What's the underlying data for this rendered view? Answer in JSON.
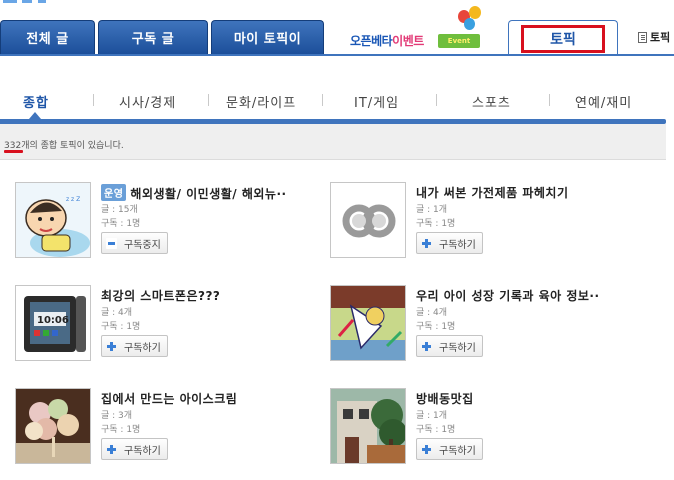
{
  "tabs": {
    "all_posts": "전체 글",
    "subscribed_posts": "구독 글",
    "my_topics": "마이 토픽이",
    "event": {
      "text_blue": "오픈베타",
      "text_pink": "이벤트",
      "ribbon": "Event"
    },
    "topic": "토픽",
    "right_cut": "토픽"
  },
  "subnav": {
    "items": [
      "종합",
      "시사/경제",
      "문화/라이프",
      "IT/게임",
      "스포츠",
      "연예/재미"
    ],
    "active_index": 0
  },
  "count": {
    "number": "332",
    "suffix": "개의 종합 토픽이 있습니다."
  },
  "topics": [
    {
      "badge": "운영",
      "title": "해외생활/ 이민생활/ 해외뉴··",
      "posts": "글 : 15개",
      "subscribers": "구독 : 1명",
      "button": "구독중지",
      "button_icon": "minus-icon",
      "thumb": "baby"
    },
    {
      "badge": "",
      "title": "내가 써본 가전제품 파헤치기",
      "posts": "글 : 1개",
      "subscribers": "구독 : 1명",
      "button": "구독하기",
      "button_icon": "plus-icon",
      "thumb": "default"
    },
    {
      "badge": "",
      "title": "최강의 스마트폰은???",
      "posts": "글 : 4개",
      "subscribers": "구독 : 1명",
      "button": "구독하기",
      "button_icon": "plus-icon",
      "thumb": "phone"
    },
    {
      "badge": "",
      "title": "우리 아이 성장 기록과 육아 정보··",
      "posts": "글 : 4개",
      "subscribers": "구독 : 1명",
      "button": "구독하기",
      "button_icon": "plus-icon",
      "thumb": "drawing"
    },
    {
      "badge": "",
      "title": "집에서 만드는 아이스크림",
      "posts": "글 : 3개",
      "subscribers": "구독 : 1명",
      "button": "구독하기",
      "button_icon": "plus-icon",
      "thumb": "icecream"
    },
    {
      "badge": "",
      "title": "방배동맛집",
      "posts": "글 : 1개",
      "subscribers": "구독 : 1명",
      "button": "구독하기",
      "button_icon": "plus-icon",
      "thumb": "house"
    }
  ],
  "colors": {
    "tab_blue": "#1c4f9a",
    "accent_red": "#d8101e",
    "link_blue": "#1f56a8",
    "badge_blue": "#6a9fd8"
  }
}
